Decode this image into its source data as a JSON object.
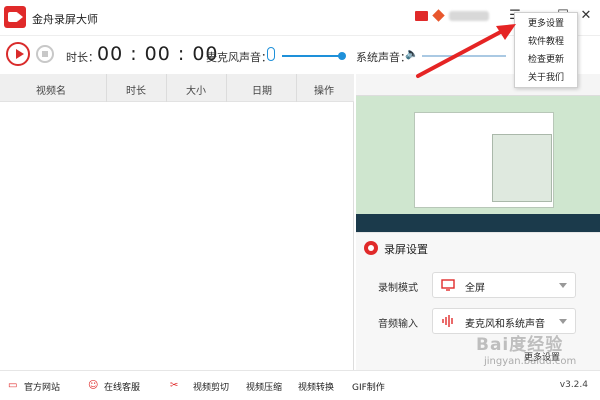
{
  "app": {
    "title": "金舟录屏大师",
    "accent": "#e02a2a",
    "blue": "#1e90d9"
  },
  "titlebar": {
    "menu_icon": "hamburger-icon",
    "minimize": "—",
    "maximize": "☐",
    "close": "✕"
  },
  "toolbar": {
    "duration_label": "时长：",
    "timer": "00 : 00 : 00",
    "mic_label": "麦克风声音：",
    "system_label": "系统声音："
  },
  "list": {
    "columns": [
      "视频名",
      "时长",
      "大小",
      "日期",
      "操作"
    ]
  },
  "settings": {
    "title": "录屏设置",
    "mode_label": "录制模式",
    "mode_value": "全屏",
    "audio_label": "音频输入",
    "audio_value": "麦克风和系统声音",
    "more": "更多设置"
  },
  "statusbar": {
    "items": [
      "官方网站",
      "在线客服",
      "视频剪切",
      "视频压缩",
      "视频转换",
      "GIF制作"
    ],
    "version": "v3.2.4"
  },
  "menu": {
    "items": [
      "更多设置",
      "软件教程",
      "检查更新",
      "关于我们"
    ]
  },
  "watermark": {
    "brand": "Bai度经验",
    "url": "jingyan.baidu.com"
  }
}
